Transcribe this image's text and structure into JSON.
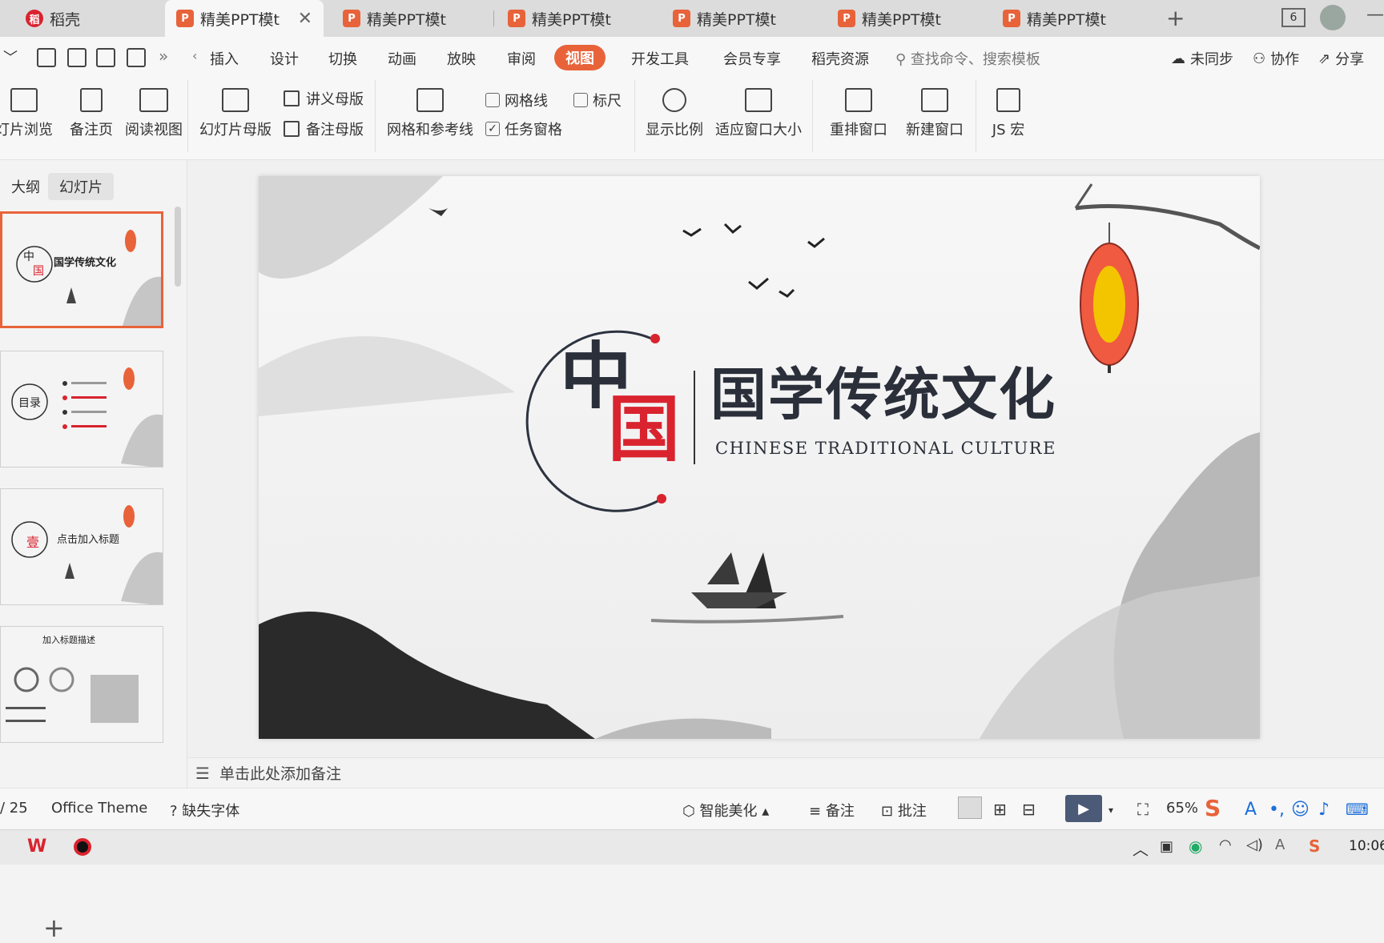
{
  "tabs": [
    {
      "label": "稻壳",
      "active": false
    },
    {
      "label": "精美PPT模t",
      "active": true
    },
    {
      "label": "精美PPT模t",
      "active": false
    },
    {
      "label": "精美PPT模t",
      "active": false
    },
    {
      "label": "精美PPT模t",
      "active": false
    },
    {
      "label": "精美PPT模t",
      "active": false
    },
    {
      "label": "精美PPT模t",
      "active": false
    }
  ],
  "tab_count": "6",
  "menu": [
    "插入",
    "设计",
    "切换",
    "动画",
    "放映",
    "审阅",
    "视图",
    "开发工具",
    "会员专享",
    "稻壳资源"
  ],
  "menu_selected": "视图",
  "search_placeholder": "查找命令、搜索模板",
  "menu_right": {
    "sync": "未同步",
    "collab": "协作",
    "share": "分享"
  },
  "ribbon": {
    "slide_browse": "灯片浏览",
    "notes_page": "备注页",
    "reading_view": "阅读视图",
    "slide_master": "幻灯片母版",
    "handout_master": "讲义母版",
    "notes_master": "备注母版",
    "grid_guides": "网格和参考线",
    "gridlines": "网格线",
    "ruler": "标尺",
    "task_pane": "任务窗格",
    "zoom": "显示比例",
    "fit_window": "适应窗口大小",
    "arrange": "重排窗口",
    "new_window": "新建窗口",
    "js_macro": "JS 宏"
  },
  "panel_tabs": [
    "大纲",
    "幻灯片"
  ],
  "thumbs": [
    {
      "title": "国学传统文化"
    },
    {
      "title": "目录"
    },
    {
      "title": "点击加入标题"
    },
    {
      "title": "加入标题描述"
    }
  ],
  "slide": {
    "char1": "中",
    "char2": "国",
    "title": "国学传统文化",
    "subtitle": "CHINESE TRADITIONAL CULTURE"
  },
  "notes_placeholder": "单击此处添加备注",
  "status": {
    "page": "/ 25",
    "theme": "Office Theme",
    "missing_font": "缺失字体",
    "beautify": "智能美化",
    "notes": "备注",
    "comments": "批注",
    "zoom": "65%"
  },
  "clock": "10:06",
  "colors": {
    "accent": "#e8633a",
    "red": "#d9232e"
  }
}
